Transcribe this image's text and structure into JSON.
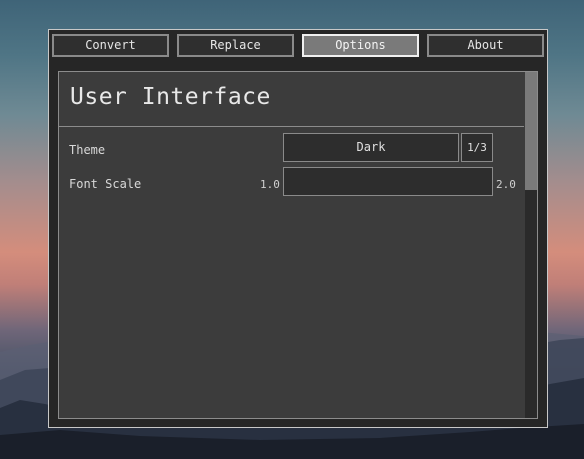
{
  "tabs": [
    {
      "label": "Convert",
      "active": false
    },
    {
      "label": "Replace",
      "active": false
    },
    {
      "label": "Options",
      "active": true
    },
    {
      "label": "About",
      "active": false
    }
  ],
  "panel": {
    "title": "User Interface",
    "settings": {
      "theme": {
        "label": "Theme",
        "value": "Dark",
        "counter": "1/3"
      },
      "font_scale": {
        "label": "Font Scale",
        "min_label": "1.0",
        "max_label": "2.0",
        "value_fraction": 0
      }
    },
    "scrollbar": {
      "position_fraction": 0
    }
  },
  "colors": {
    "window_bg": "#262626",
    "panel_bg": "#3c3c3c",
    "active_tab_bg": "#7a7a7a"
  }
}
